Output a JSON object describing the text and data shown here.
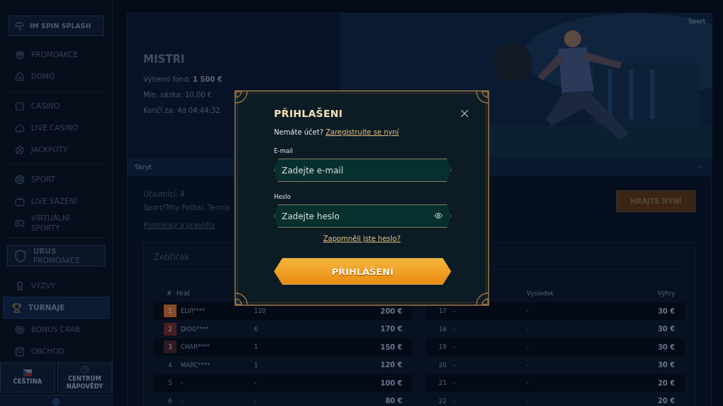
{
  "sidebar": {
    "brand": "IM SPIN SPLASH",
    "groups": [
      [
        {
          "label": "PROMOAKCE",
          "selected": false
        },
        {
          "label": "DOMŮ",
          "selected": false
        }
      ],
      [
        {
          "label": "CASINO",
          "selected": false
        },
        {
          "label": "LIVE CASINO",
          "selected": false
        },
        {
          "label": "JACKPOTY",
          "selected": false
        }
      ],
      [
        {
          "label": "SPORT",
          "selected": false
        },
        {
          "label": "LIVE SÁZENÍ",
          "selected": false
        },
        {
          "label": "VIRTUÁLNÍ SPORTY",
          "selected": false
        }
      ]
    ],
    "promo": {
      "title": "URUS",
      "subtitle": "PROMOAKCE"
    },
    "more": [
      {
        "label": "VÝZVY",
        "selected": false
      },
      {
        "label": "TURNAJE",
        "selected": true
      },
      {
        "label": "BONUS CRAB",
        "selected": false
      },
      {
        "label": "OBCHOD",
        "selected": false
      }
    ],
    "language": "ČEŠTINA",
    "help": "CENTRUM NÁPOVĚDY"
  },
  "hero": {
    "tag": "Sport",
    "title": "MISTRI",
    "lines": [
      "Výherní fond: **1 500 €**",
      "Min. sázka: 10,00 €",
      "Končí za: 4d 04:44:32"
    ]
  },
  "collapse": {
    "label": "Skryt",
    "expanded": true
  },
  "info": {
    "participants": "Účastníci: 4",
    "markets": "Sport/Trhy Fotbal, Tennis",
    "rules_link": "Podmínky a pravidla",
    "play_button": "HRAJTE NYNÍ"
  },
  "leaderboard": {
    "title": "Žebříček",
    "left": {
      "headers": [
        "#",
        "Hráč"
      ],
      "rows": [
        {
          "rank": "1",
          "player": "ELVI****",
          "result": "120",
          "prize": "200 €",
          "color": "#8a4a2a"
        },
        {
          "rank": "2",
          "player": "DIOG****",
          "result": "6",
          "prize": "170 €",
          "color": "#4a1e22"
        },
        {
          "rank": "3",
          "player": "CHAR****",
          "result": "1",
          "prize": "150 €",
          "color": "#2e1a20"
        },
        {
          "rank": "4",
          "player": "MARC****",
          "result": "1",
          "prize": "120 €"
        },
        {
          "rank": "5",
          "player": "-",
          "result": "-",
          "prize": "100 €"
        },
        {
          "rank": "6",
          "player": "-",
          "result": "-",
          "prize": "80 €"
        }
      ]
    },
    "right": {
      "headers": [
        "Vysledek",
        "Výhry"
      ],
      "rows": [
        {
          "rank": "17",
          "player": "-",
          "result": "-",
          "prize": "30 €"
        },
        {
          "rank": "18",
          "player": "-",
          "result": "-",
          "prize": "30 €"
        },
        {
          "rank": "19",
          "player": "-",
          "result": "-",
          "prize": "30 €"
        },
        {
          "rank": "20",
          "player": "-",
          "result": "-",
          "prize": "30 €"
        },
        {
          "rank": "21",
          "player": "-",
          "result": "-",
          "prize": "20 €"
        },
        {
          "rank": "22",
          "player": "-",
          "result": "-",
          "prize": "20 €"
        }
      ]
    }
  },
  "login": {
    "title": "PŘIHLAŠENI",
    "prompt": "Nemáte účet?",
    "register_link": "Zaregistrujte se nyní",
    "fields": [
      {
        "kind": "text",
        "label": "E-mail",
        "placeholder": "Zadejte e-mail"
      },
      {
        "kind": "password",
        "label": "Heslo",
        "placeholder": "Zadejte heslo"
      }
    ],
    "forgot_link": "Zapomněli jste heslo?",
    "submit": "PŘIHLÁŠENÍ"
  }
}
